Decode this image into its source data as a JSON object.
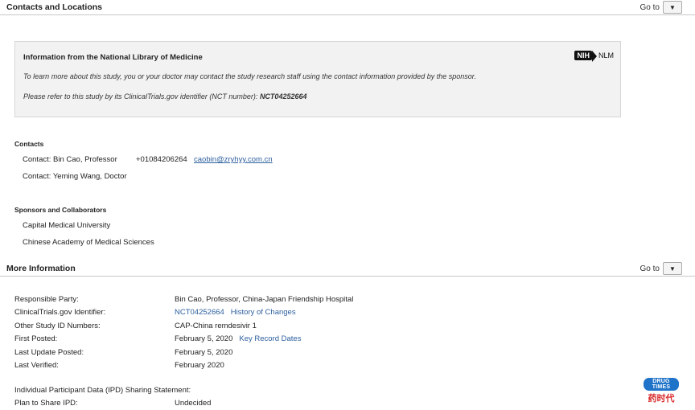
{
  "contacts_section": {
    "title": "Contacts and Locations",
    "goto_label": "Go to"
  },
  "nlm_box": {
    "title": "Information from the National Library of Medicine",
    "line1": "To learn more about this study, you or your doctor may contact the study research staff using the contact information provided by the sponsor.",
    "line2_prefix": "Please refer to this study by its ClinicalTrials.gov identifier (NCT number): ",
    "nct_number": "NCT04252664",
    "logo_nih": "NIH",
    "logo_nlm": "NLM"
  },
  "contacts": {
    "heading": "Contacts",
    "items": [
      {
        "label": "Contact: Bin Cao, Professor",
        "phone": "+01084206264",
        "email": "caobin@zryhyy.com.cn"
      },
      {
        "label": "Contact: Yeming Wang, Doctor"
      }
    ]
  },
  "sponsors": {
    "heading": "Sponsors and Collaborators",
    "items": [
      "Capital Medical University",
      "Chinese Academy of Medical Sciences"
    ]
  },
  "more_info_section": {
    "title": "More Information",
    "goto_label": "Go to"
  },
  "more_info": {
    "rows": [
      {
        "label": "Responsible Party:",
        "value": "Bin Cao, Professor, China-Japan Friendship Hospital"
      },
      {
        "label": "ClinicalTrials.gov Identifier:",
        "link1": "NCT04252664",
        "link2": "History of Changes"
      },
      {
        "label": "Other Study ID Numbers:",
        "value": "CAP-China remdesivir 1"
      },
      {
        "label": "First Posted:",
        "value": "February 5, 2020",
        "link1": "Key Record Dates"
      },
      {
        "label": "Last Update Posted:",
        "value": "February 5, 2020"
      },
      {
        "label": "Last Verified:",
        "value": "February 2020"
      }
    ],
    "ipd_label": "Individual Participant Data (IPD) Sharing Statement:",
    "plan_label": "Plan to Share IPD:",
    "plan_value": "Undecided"
  },
  "watermark": {
    "top": "DRUG TIMES",
    "bottom": "药时代"
  }
}
